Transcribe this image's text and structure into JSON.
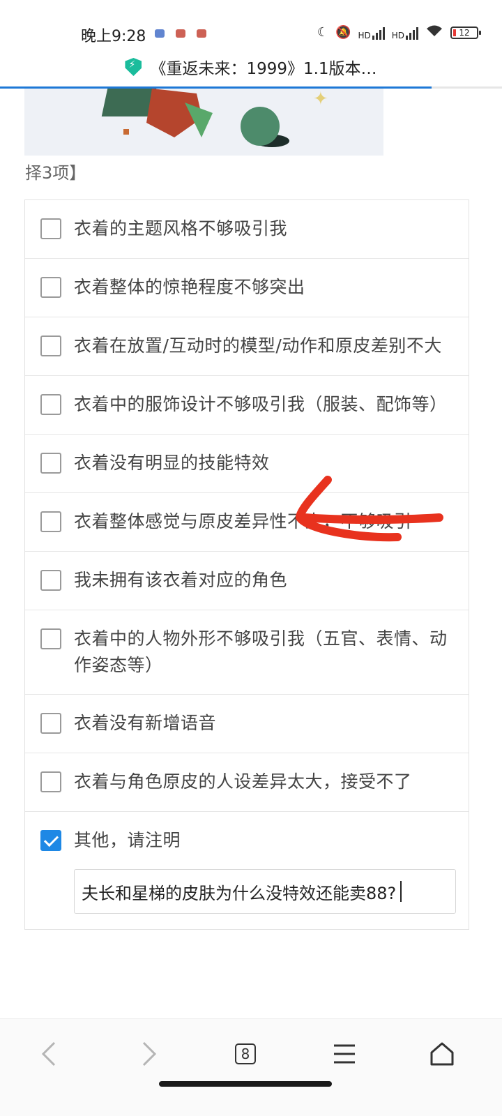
{
  "status_bar": {
    "time": "晚上9:28",
    "network_labels": [
      "HD",
      "HD"
    ],
    "battery_level": "12"
  },
  "page": {
    "title": "《重返未来：1999》1.1版本…",
    "load_progress_percent": 86
  },
  "question": {
    "select_hint": "择3项】",
    "options": [
      {
        "label": "衣着的主题风格不够吸引我",
        "checked": false
      },
      {
        "label": "衣着整体的惊艳程度不够突出",
        "checked": false
      },
      {
        "label": "衣着在放置/互动时的模型/动作和原皮差别不大",
        "checked": false
      },
      {
        "label": "衣着中的服饰设计不够吸引我（服装、配饰等）",
        "checked": false
      },
      {
        "label": "衣着没有明显的技能特效",
        "checked": false
      },
      {
        "label": "衣着整体感觉与原皮差异性不大，不够吸引",
        "checked": false
      },
      {
        "label": "我未拥有该衣着对应的角色",
        "checked": false
      },
      {
        "label": "衣着中的人物外形不够吸引我（五官、表情、动作姿态等）",
        "checked": false
      },
      {
        "label": "衣着没有新增语音",
        "checked": false
      },
      {
        "label": "衣着与角色原皮的人设差异太大，接受不了",
        "checked": false
      },
      {
        "label": "其他，请注明",
        "checked": true
      }
    ],
    "other_input_value": "夫长和星梯的皮肤为什么没特效还能卖88?"
  },
  "bottom_nav": {
    "tabs_count": "8",
    "icons": [
      "back-icon",
      "forward-icon",
      "tabs-icon",
      "menu-icon",
      "home-icon"
    ]
  },
  "colors": {
    "accent": "#1e88e5",
    "annotation": "#e8321e"
  }
}
